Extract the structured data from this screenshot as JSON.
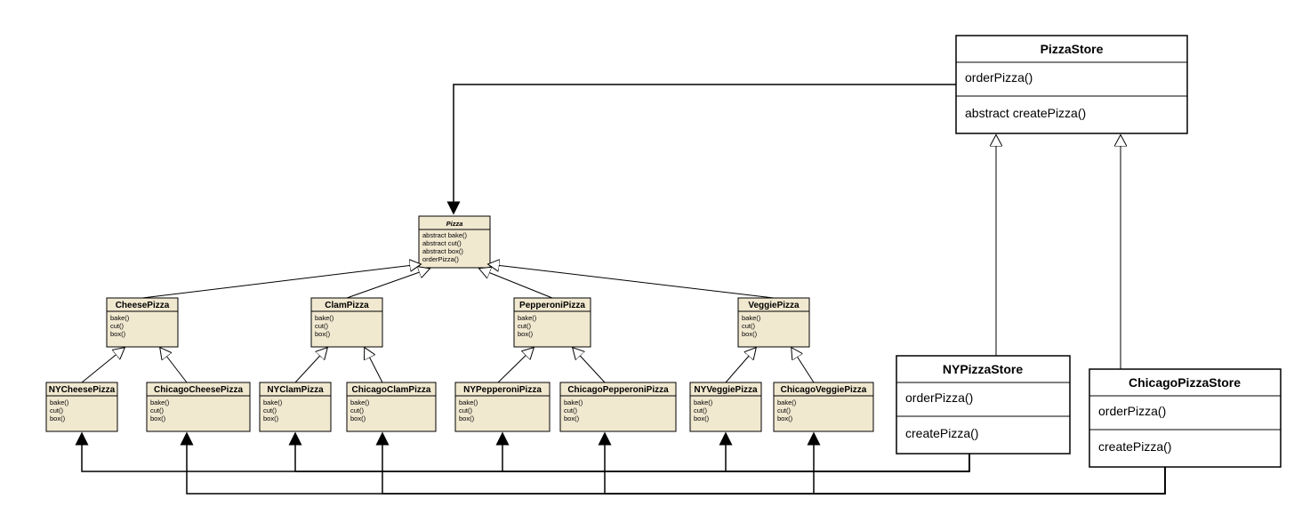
{
  "stores": {
    "PizzaStore": {
      "title": "PizzaStore",
      "methods": [
        "orderPizza()",
        "abstract createPizza()"
      ]
    },
    "NYPizzaStore": {
      "title": "NYPizzaStore",
      "methods": [
        "orderPizza()",
        "createPizza()"
      ]
    },
    "ChicagoPizzaStore": {
      "title": "ChicagoPizzaStore",
      "methods": [
        "orderPizza()",
        "createPizza()"
      ]
    }
  },
  "pizza": {
    "title": "Pizza",
    "methods": [
      "abstract bake()",
      "abstract cut()",
      "abstract box()",
      "orderPizza()"
    ]
  },
  "level2": [
    {
      "id": "CheesePizza",
      "title": "CheesePizza",
      "methods": [
        "bake()",
        "cut()",
        "box()"
      ]
    },
    {
      "id": "ClamPizza",
      "title": "ClamPizza",
      "methods": [
        "bake()",
        "cut()",
        "box()"
      ]
    },
    {
      "id": "PepperoniPizza",
      "title": "PepperoniPizza",
      "methods": [
        "bake()",
        "cut()",
        "box()"
      ]
    },
    {
      "id": "VeggiePizza",
      "title": "VeggiePizza",
      "methods": [
        "bake()",
        "cut()",
        "box()"
      ]
    }
  ],
  "level3": [
    {
      "id": "NYCheesePizza",
      "title": "NYCheesePizza",
      "methods": [
        "bake()",
        "cut()",
        "box()"
      ]
    },
    {
      "id": "ChicagoCheesePizza",
      "title": "ChicagoCheesePizza",
      "methods": [
        "bake()",
        "cut()",
        "box()"
      ]
    },
    {
      "id": "NYClamPizza",
      "title": "NYClamPizza",
      "methods": [
        "bake()",
        "cut()",
        "box()"
      ]
    },
    {
      "id": "ChicagoClamPizza",
      "title": "ChicagoClamPizza",
      "methods": [
        "bake()",
        "cut()",
        "box()"
      ]
    },
    {
      "id": "NYPepperoniPizza",
      "title": "NYPepperoniPizza",
      "methods": [
        "bake()",
        "cut()",
        "box()"
      ]
    },
    {
      "id": "ChicagoPepperoniPizza",
      "title": "ChicagoPepperoniPizza",
      "methods": [
        "bake()",
        "cut()",
        "box()"
      ]
    },
    {
      "id": "NYVeggiePizza",
      "title": "NYVeggiePizza",
      "methods": [
        "bake()",
        "cut()",
        "box()"
      ]
    },
    {
      "id": "ChicagoVeggiePizza",
      "title": "ChicagoVeggiePizza",
      "methods": [
        "bake()",
        "cut()",
        "box()"
      ]
    }
  ]
}
